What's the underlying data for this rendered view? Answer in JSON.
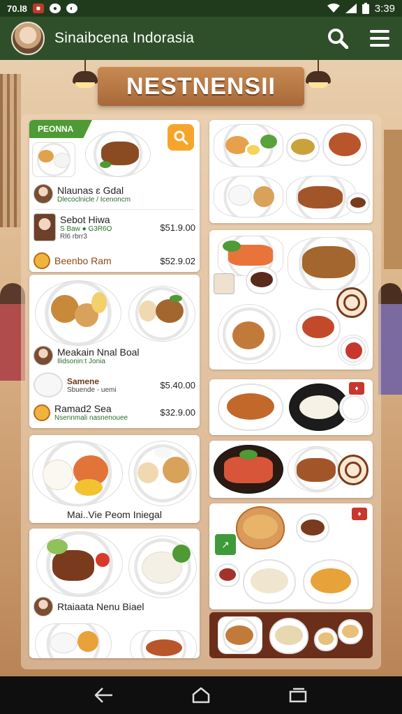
{
  "status": {
    "time_left": "70.l8",
    "clock": "3:39"
  },
  "app": {
    "title": "Sinaibcena Indorasia"
  },
  "banner": {
    "text": "NESTNENSII"
  },
  "card1": {
    "ribbon": "PEONNA",
    "items": [
      {
        "name": "Nlaunas ɛ Gdal",
        "sub": "Dlecoclnicle / Icenoncm",
        "price": ""
      },
      {
        "name": "Sebot Hiwa",
        "sub": "S Baw ● G3R6O",
        "sub2": "Rl6 rbrr3",
        "price": "$51.9.00"
      },
      {
        "name": "Beenbo Ram",
        "sub": "",
        "price": "$52.9.02"
      }
    ]
  },
  "card2": {
    "items": [
      {
        "name": "Meakain Nnal Boal",
        "sub": "Ilidsonin:t Jonia",
        "price": ""
      },
      {
        "name": "Samene",
        "sub": "Sbuende - uemi",
        "price": "$5.40.00"
      },
      {
        "name": "Ramad2 Sea",
        "sub": "Nsennmali nasnenouee",
        "price": "$32.9.00"
      }
    ]
  },
  "card3": {
    "title": "Mai..Vie Peom Iniegal"
  },
  "card4": {
    "title": "Rtaiaata Nenu Biael"
  },
  "colors": {
    "status_bar": "#1f3b1c",
    "app_bar": "#2f4f2a",
    "accent_green": "#4e9a34",
    "accent_orange": "#f6a52b",
    "dark_strip": "#6b2e1a"
  },
  "icons": [
    "avatar",
    "search-icon",
    "menu-icon",
    "back-icon",
    "home-icon",
    "recents-icon",
    "wifi-icon",
    "signal-icon",
    "battery-icon"
  ]
}
